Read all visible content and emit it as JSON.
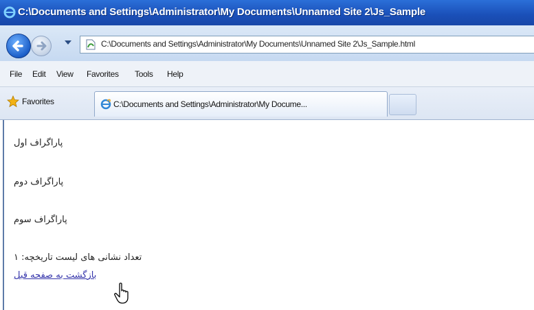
{
  "window": {
    "title": "C:\\Documents and Settings\\Administrator\\My Documents\\Unnamed Site 2\\Js_Sample"
  },
  "address_bar": {
    "url": "C:\\Documents and Settings\\Administrator\\My Documents\\Unnamed Site 2\\Js_Sample.html"
  },
  "menu": {
    "items": [
      "File",
      "Edit",
      "View",
      "Favorites",
      "Tools",
      "Help"
    ]
  },
  "favorites_bar": {
    "favorites_label": "Favorites",
    "active_tab_label": "C:\\Documents and Settings\\Administrator\\My Docume..."
  },
  "page": {
    "paragraphs": [
      "پاراگراف اول",
      "پاراگراف دوم",
      "پاراگراف سوم"
    ],
    "history_count_text": "تعداد نشانی های لیست تاریخچه: ۱",
    "back_link": "بازگشت به صفحه قبل"
  },
  "colors": {
    "titlebar": "#1a4fb8",
    "link": "#3333aa"
  },
  "icons": [
    "ie-icon",
    "back-arrow-icon",
    "forward-arrow-icon",
    "page-icon",
    "favorites-star-icon",
    "hand-cursor-icon"
  ]
}
